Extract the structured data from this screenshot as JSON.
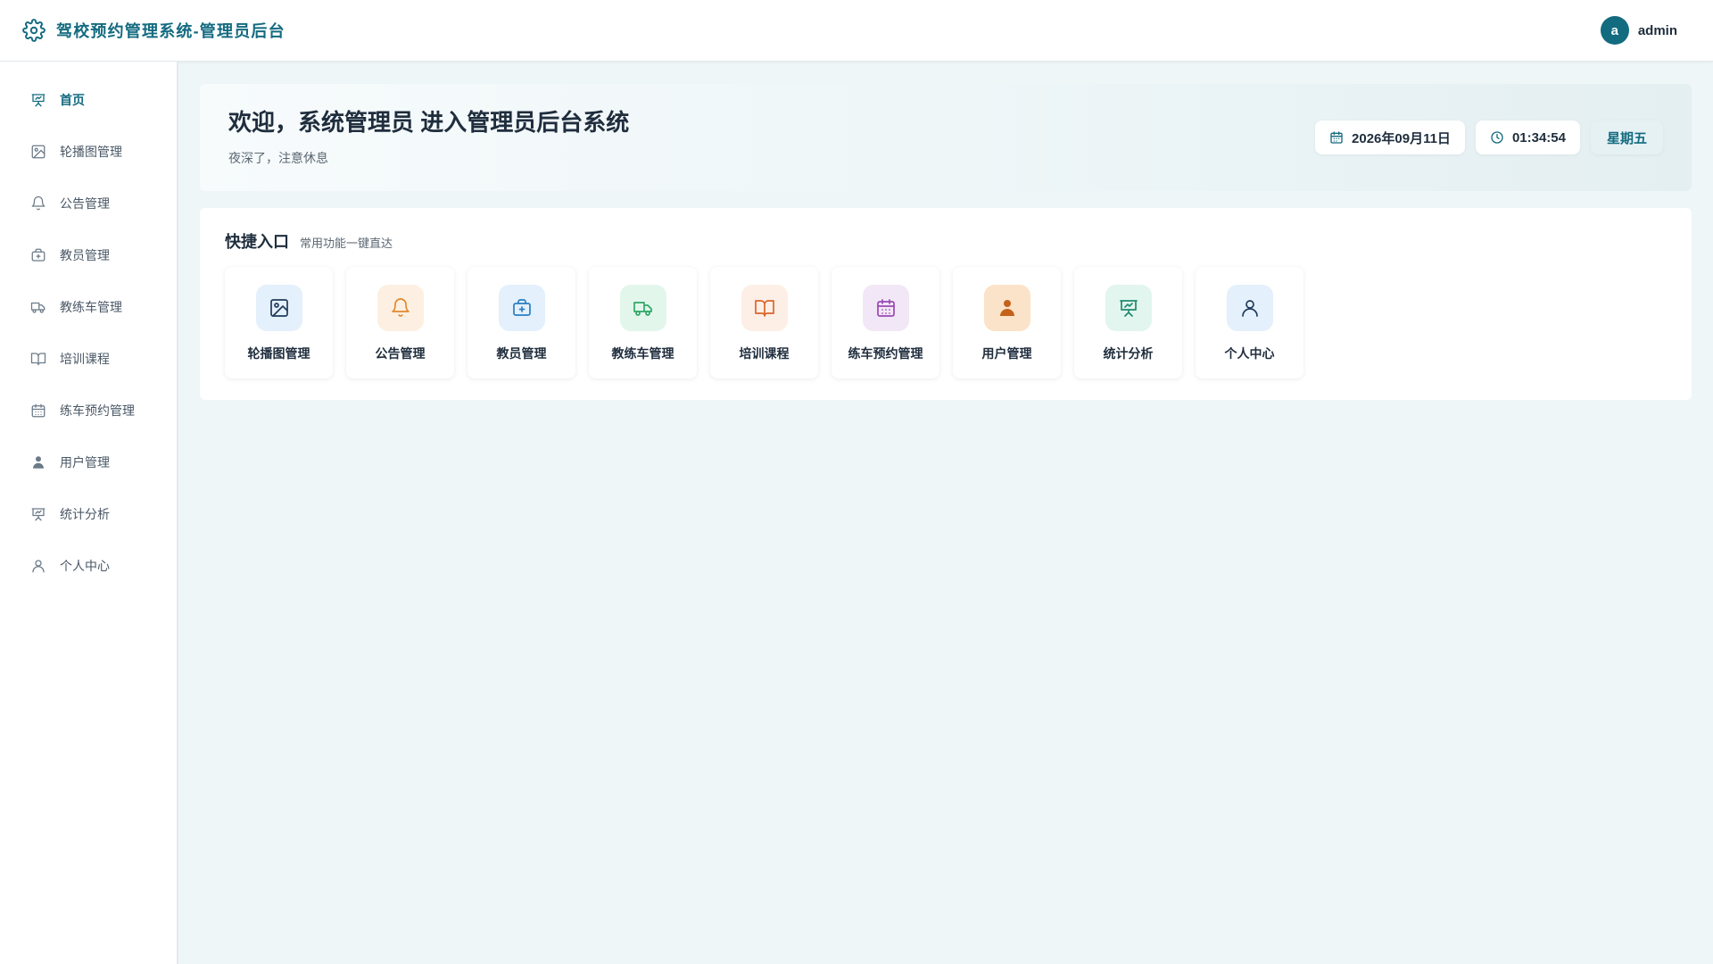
{
  "header": {
    "title": "驾校预约管理系统-管理员后台",
    "avatar_letter": "a",
    "username": "admin"
  },
  "sidebar": {
    "items": [
      {
        "label": "首页",
        "icon": "dashboard-icon",
        "active": true
      },
      {
        "label": "轮播图管理",
        "icon": "image-icon"
      },
      {
        "label": "公告管理",
        "icon": "bell-icon"
      },
      {
        "label": "教员管理",
        "icon": "medical-bag-icon"
      },
      {
        "label": "教练车管理",
        "icon": "truck-icon"
      },
      {
        "label": "培训课程",
        "icon": "book-icon"
      },
      {
        "label": "练车预约管理",
        "icon": "calendar-icon"
      },
      {
        "label": "用户管理",
        "icon": "user-filled-icon"
      },
      {
        "label": "统计分析",
        "icon": "chart-board-icon"
      },
      {
        "label": "个人中心",
        "icon": "user-icon"
      }
    ]
  },
  "welcome": {
    "title": "欢迎，系统管理员 进入管理员后台系统",
    "subtitle": "夜深了，注意休息",
    "date": "2026年09月11日",
    "time": "01:34:54",
    "weekday": "星期五"
  },
  "quick": {
    "title": "快捷入口",
    "subtitle": "常用功能一键直达",
    "items": [
      {
        "label": "轮播图管理",
        "icon": "image-icon",
        "bg": "#e4f0fb",
        "color": "#1f3b5a"
      },
      {
        "label": "公告管理",
        "icon": "bell-icon",
        "bg": "#fdf0e2",
        "color": "#e28a2c"
      },
      {
        "label": "教员管理",
        "icon": "medical-bag-icon",
        "bg": "#e4f0fb",
        "color": "#2a7ec4"
      },
      {
        "label": "教练车管理",
        "icon": "truck-icon",
        "bg": "#e3f6ec",
        "color": "#2fa866"
      },
      {
        "label": "培训课程",
        "icon": "book-icon",
        "bg": "#fdefe6",
        "color": "#d9662a"
      },
      {
        "label": "练车预约管理",
        "icon": "calendar-icon",
        "bg": "#f2e7f6",
        "color": "#9a49b5"
      },
      {
        "label": "用户管理",
        "icon": "user-filled-icon",
        "bg": "#fbe3c9",
        "color": "#c4611a"
      },
      {
        "label": "统计分析",
        "icon": "chart-board-icon",
        "bg": "#e2f5ef",
        "color": "#1f8a6e"
      },
      {
        "label": "个人中心",
        "icon": "user-icon",
        "bg": "#e4f0fb",
        "color": "#1f3b5a"
      }
    ]
  },
  "colors": {
    "primary": "#136b80",
    "background": "#eef6f7"
  }
}
